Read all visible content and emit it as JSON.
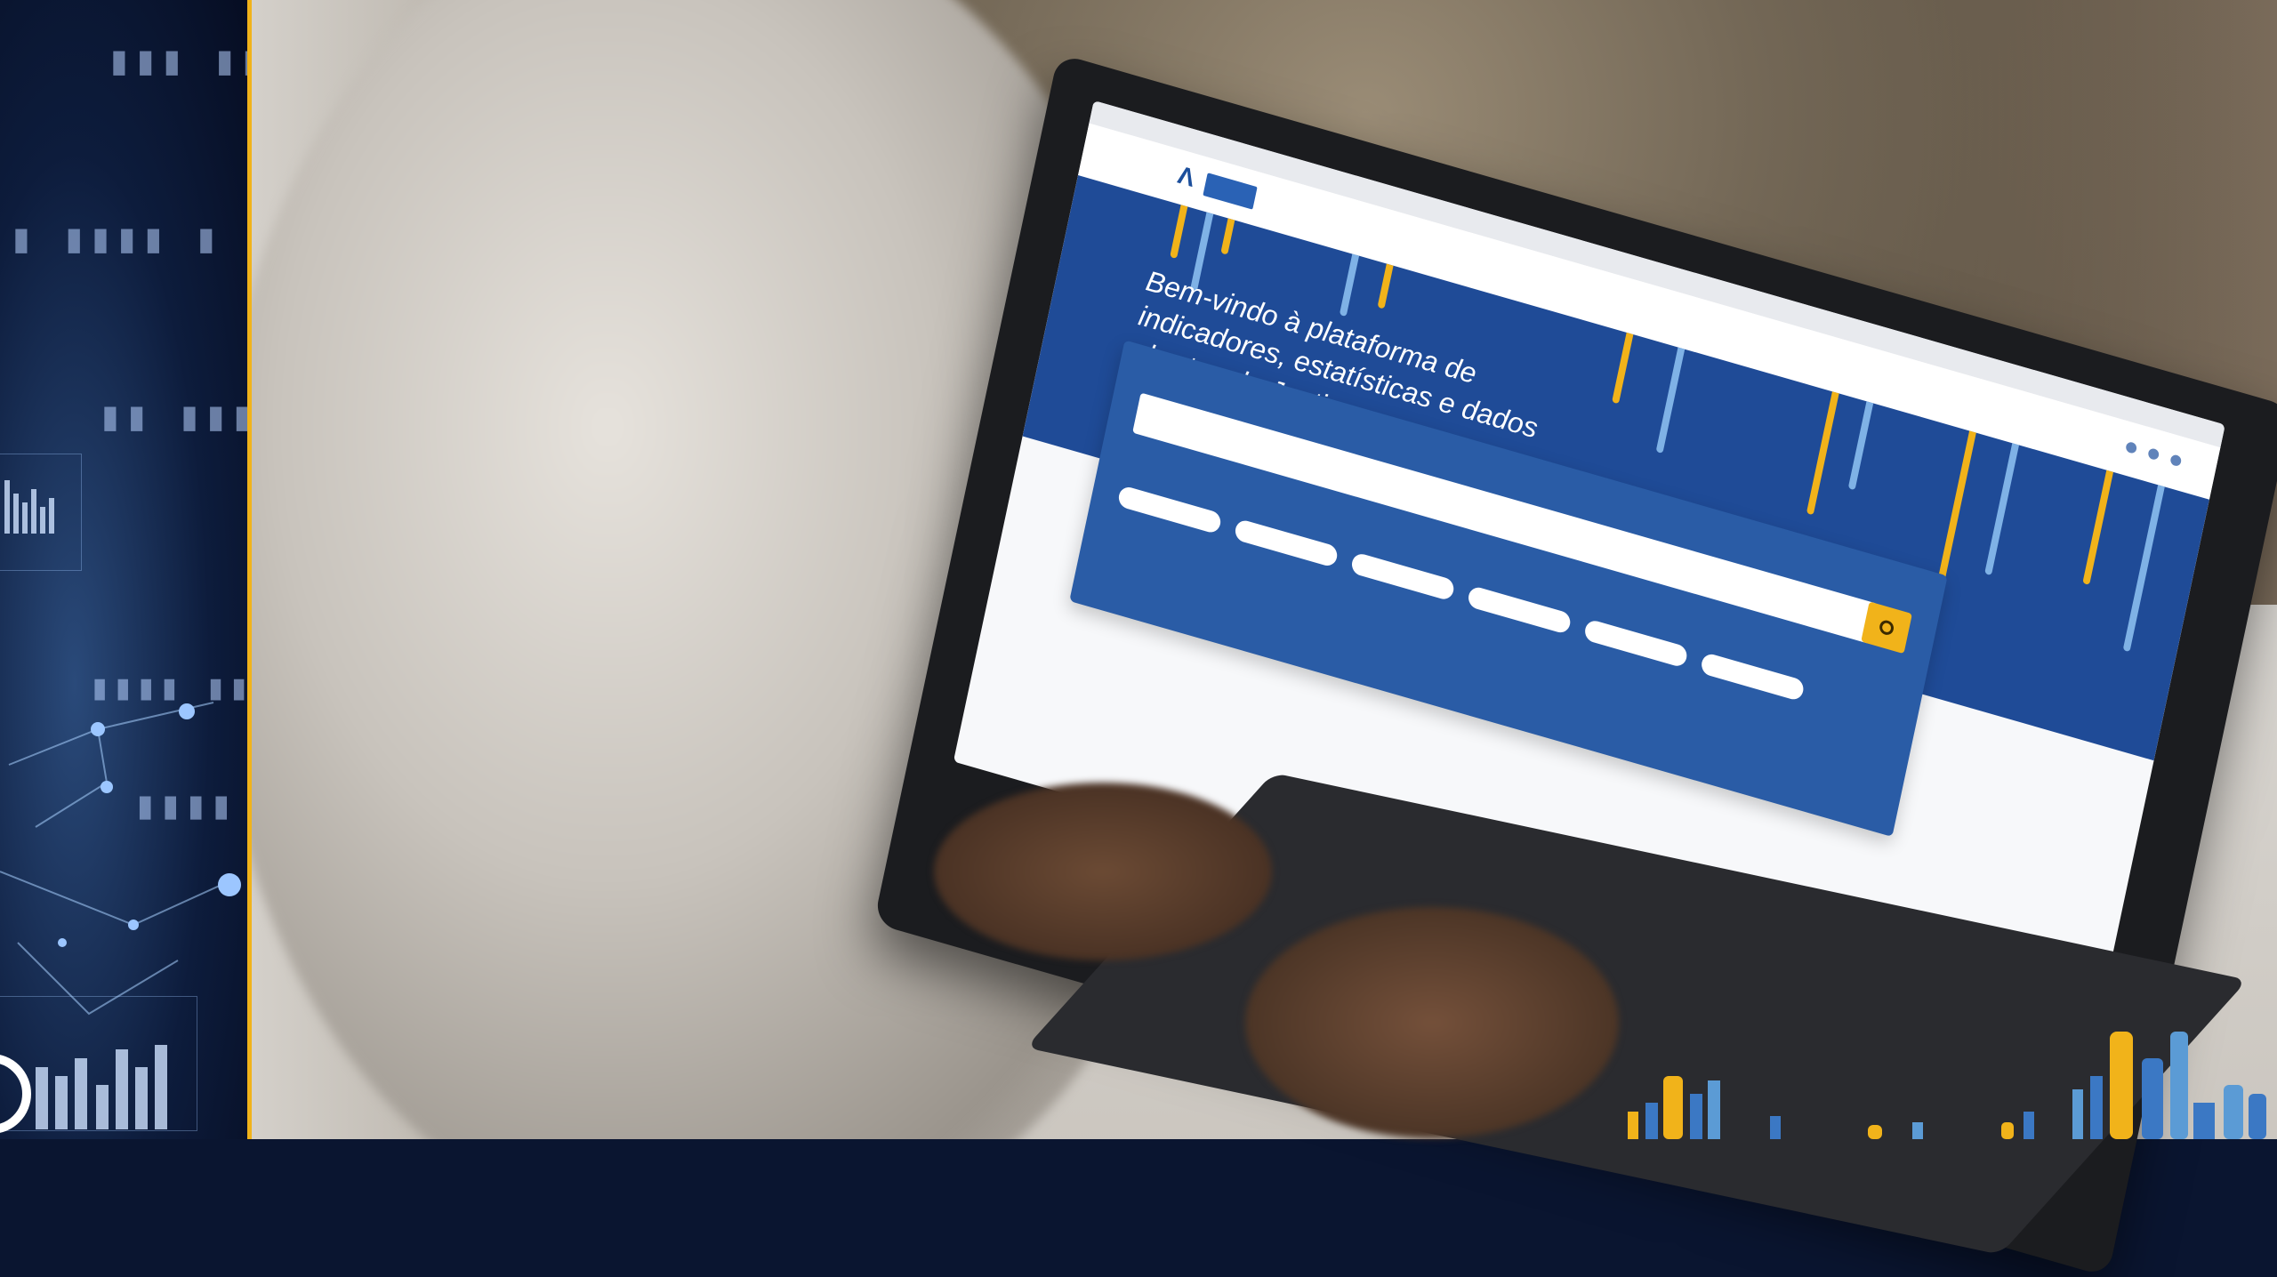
{
  "screen": {
    "site_name": "Λ",
    "hero_title": "Bem-vindo à plataforma de indicadores, estatísticas e dados abertos da Justiça",
    "hero_links": [
      "",
      "",
      ""
    ],
    "search_label": "",
    "search_placeholder": "",
    "suggest_label": "",
    "chips": [
      "",
      "",
      "",
      "",
      "",
      ""
    ]
  },
  "colors": {
    "brand_blue": "#1f4b97",
    "accent_gold": "#f1b31a",
    "light_blue": "#5b9bd5",
    "dark_navy": "#0a1530"
  },
  "icons": [
    "search-icon"
  ]
}
